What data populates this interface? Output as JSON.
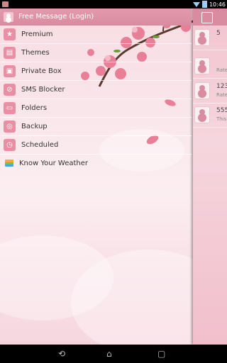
{
  "status_bar": {
    "time": "10:46"
  },
  "drawer": {
    "header_label": "Free Message (Login)",
    "items": [
      {
        "label": "Premium",
        "icon": "ribbon-icon"
      },
      {
        "label": "Themes",
        "icon": "themes-icon"
      },
      {
        "label": "Private Box",
        "icon": "private-box-icon"
      },
      {
        "label": "SMS Blocker",
        "icon": "sms-blocker-icon"
      },
      {
        "label": "Folders",
        "icon": "folder-icon"
      },
      {
        "label": "Backup",
        "icon": "backup-icon"
      },
      {
        "label": "Scheduled",
        "icon": "clock-icon"
      },
      {
        "label": "Know Your Weather",
        "icon": "weather-icon"
      }
    ]
  },
  "conversations": [
    {
      "title": "5",
      "preview": ""
    },
    {
      "title": "",
      "preview": "Rate"
    },
    {
      "title": "123",
      "preview": "Rate"
    },
    {
      "title": "555",
      "preview": "This"
    }
  ],
  "colors": {
    "accent": "#d98ba0",
    "icon_bg": "#e88fa4"
  }
}
